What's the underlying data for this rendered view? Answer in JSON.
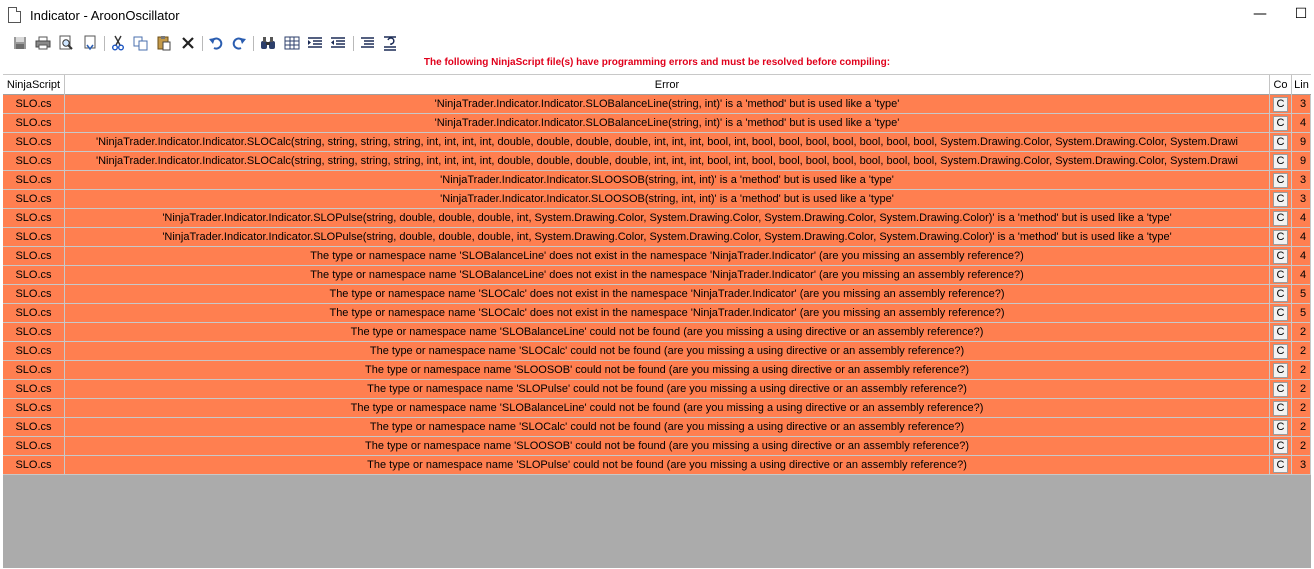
{
  "window": {
    "title": "Indicator - AroonOscillator",
    "minimize_glyph": "—",
    "maximize_glyph": "☐"
  },
  "toolbar": {
    "icons": [
      "save-icon",
      "print-icon",
      "print-preview-icon",
      "page-setup-icon",
      "cut-icon",
      "copy-icon",
      "paste-icon",
      "delete-icon",
      "undo-icon",
      "redo-icon",
      "find-icon",
      "grid-icon",
      "indent-icon",
      "outdent-icon",
      "comment-icon",
      "uncomment-icon"
    ]
  },
  "banner": "The following NinjaScript file(s) have programming errors and must be resolved before compiling:",
  "columns": {
    "script": "NinjaScript",
    "error": "Error",
    "column": "Co",
    "line": "Lin"
  },
  "colors": {
    "error_row": "#ff7f50",
    "banner_text": "#e0001b",
    "grid_background": "#ababab"
  },
  "rows": [
    {
      "script": "SLO.cs",
      "error": "'NinjaTrader.Indicator.Indicator.SLOBalanceLine(string, int)' is a 'method' but is used like a 'type'",
      "col": "C",
      "line": "3"
    },
    {
      "script": "SLO.cs",
      "error": "'NinjaTrader.Indicator.Indicator.SLOBalanceLine(string, int)' is a 'method' but is used like a 'type'",
      "col": "C",
      "line": "4"
    },
    {
      "script": "SLO.cs",
      "error": "'NinjaTrader.Indicator.Indicator.SLOCalc(string, string, string, string, int, int, int, int, double, double, double, double, int, int, int, bool, int, bool, bool, bool, bool, bool, bool, bool, System.Drawing.Color, System.Drawing.Color, System.Drawi",
      "col": "C",
      "line": "9"
    },
    {
      "script": "SLO.cs",
      "error": "'NinjaTrader.Indicator.Indicator.SLOCalc(string, string, string, string, int, int, int, int, double, double, double, double, int, int, int, bool, int, bool, bool, bool, bool, bool, bool, bool, System.Drawing.Color, System.Drawing.Color, System.Drawi",
      "col": "C",
      "line": "9"
    },
    {
      "script": "SLO.cs",
      "error": "'NinjaTrader.Indicator.Indicator.SLOOSOB(string, int, int)' is a 'method' but is used like a 'type'",
      "col": "C",
      "line": "3"
    },
    {
      "script": "SLO.cs",
      "error": "'NinjaTrader.Indicator.Indicator.SLOOSOB(string, int, int)' is a 'method' but is used like a 'type'",
      "col": "C",
      "line": "3"
    },
    {
      "script": "SLO.cs",
      "error": "'NinjaTrader.Indicator.Indicator.SLOPulse(string, double, double, double, int, System.Drawing.Color, System.Drawing.Color, System.Drawing.Color, System.Drawing.Color)' is a 'method' but is used like a 'type'",
      "col": "C",
      "line": "4"
    },
    {
      "script": "SLO.cs",
      "error": "'NinjaTrader.Indicator.Indicator.SLOPulse(string, double, double, double, int, System.Drawing.Color, System.Drawing.Color, System.Drawing.Color, System.Drawing.Color)' is a 'method' but is used like a 'type'",
      "col": "C",
      "line": "4"
    },
    {
      "script": "SLO.cs",
      "error": "The type or namespace name 'SLOBalanceLine' does not exist in the namespace 'NinjaTrader.Indicator' (are you missing an assembly reference?)",
      "col": "C",
      "line": "4"
    },
    {
      "script": "SLO.cs",
      "error": "The type or namespace name 'SLOBalanceLine' does not exist in the namespace 'NinjaTrader.Indicator' (are you missing an assembly reference?)",
      "col": "C",
      "line": "4"
    },
    {
      "script": "SLO.cs",
      "error": "The type or namespace name 'SLOCalc' does not exist in the namespace 'NinjaTrader.Indicator' (are you missing an assembly reference?)",
      "col": "C",
      "line": "5"
    },
    {
      "script": "SLO.cs",
      "error": "The type or namespace name 'SLOCalc' does not exist in the namespace 'NinjaTrader.Indicator' (are you missing an assembly reference?)",
      "col": "C",
      "line": "5"
    },
    {
      "script": "SLO.cs",
      "error": "The type or namespace name 'SLOBalanceLine' could not be found (are you missing a using directive or an assembly reference?)",
      "col": "C",
      "line": "2"
    },
    {
      "script": "SLO.cs",
      "error": "The type or namespace name 'SLOCalc' could not be found (are you missing a using directive or an assembly reference?)",
      "col": "C",
      "line": "2"
    },
    {
      "script": "SLO.cs",
      "error": "The type or namespace name 'SLOOSOB' could not be found (are you missing a using directive or an assembly reference?)",
      "col": "C",
      "line": "2"
    },
    {
      "script": "SLO.cs",
      "error": "The type or namespace name 'SLOPulse' could not be found (are you missing a using directive or an assembly reference?)",
      "col": "C",
      "line": "2"
    },
    {
      "script": "SLO.cs",
      "error": "The type or namespace name 'SLOBalanceLine' could not be found (are you missing a using directive or an assembly reference?)",
      "col": "C",
      "line": "2"
    },
    {
      "script": "SLO.cs",
      "error": "The type or namespace name 'SLOCalc' could not be found (are you missing a using directive or an assembly reference?)",
      "col": "C",
      "line": "2"
    },
    {
      "script": "SLO.cs",
      "error": "The type or namespace name 'SLOOSOB' could not be found (are you missing a using directive or an assembly reference?)",
      "col": "C",
      "line": "2"
    },
    {
      "script": "SLO.cs",
      "error": "The type or namespace name 'SLOPulse' could not be found (are you missing a using directive or an assembly reference?)",
      "col": "C",
      "line": "3"
    }
  ]
}
